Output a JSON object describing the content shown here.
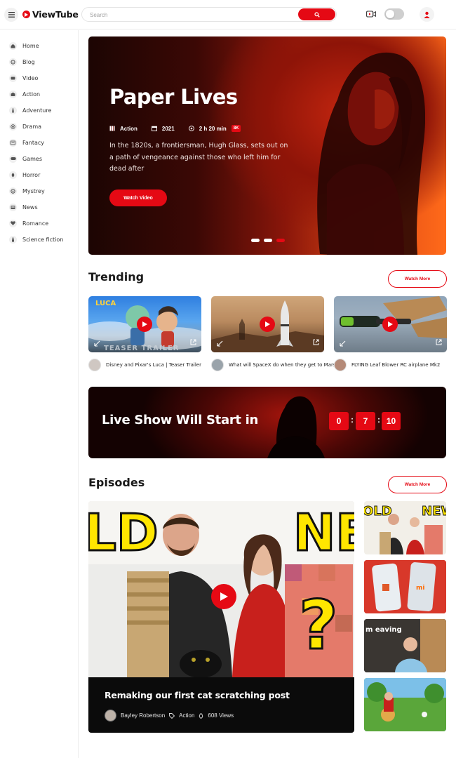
{
  "app": {
    "brand": "ViewTube",
    "search_placeholder": "Search"
  },
  "sidebar": {
    "items": [
      {
        "label": "Home",
        "icon": "home-icon"
      },
      {
        "label": "Blog",
        "icon": "blog-icon"
      },
      {
        "label": "Video",
        "icon": "video-icon"
      },
      {
        "label": "Action",
        "icon": "camera-icon"
      },
      {
        "label": "Adventure",
        "icon": "hiker-icon"
      },
      {
        "label": "Drama",
        "icon": "drama-icon"
      },
      {
        "label": "Fantacy",
        "icon": "fantasy-icon"
      },
      {
        "label": "Games",
        "icon": "gamepad-icon"
      },
      {
        "label": "Horror",
        "icon": "horror-icon"
      },
      {
        "label": "Mystrey",
        "icon": "mystery-icon"
      },
      {
        "label": "News",
        "icon": "news-icon"
      },
      {
        "label": "Romance",
        "icon": "heart-icon"
      },
      {
        "label": "Science fiction",
        "icon": "scifi-icon"
      }
    ]
  },
  "hero": {
    "title": "Paper Lives",
    "genre": "Action",
    "year": "2021",
    "duration": "2 h 20 min",
    "quality": "8K",
    "description": "In the 1820s, a frontiersman, Hugh Glass, sets out on a path of vengeance against those who left him for dead after",
    "watch_label": "Watch Video",
    "slides": 3,
    "active_slide": 3
  },
  "trending": {
    "title": "Trending",
    "watch_more": "Watch More",
    "cards": [
      {
        "title": "Disney and Pixar's Luca | Teaser Trailer",
        "overlay": "TEASER TRAILER",
        "brand": "LUCA"
      },
      {
        "title": "What will SpaceX do when they get to Mars?"
      },
      {
        "title": "FLYING Leaf Blower RC airplane Mk2"
      }
    ]
  },
  "live": {
    "title": "Live Show Will Start in",
    "countdown": [
      "0",
      "7",
      "10"
    ]
  },
  "episodes": {
    "title": "Episodes",
    "watch_more": "Watch More",
    "main": {
      "title": "Remaking our first cat scratching post",
      "author": "Bayley Robertson",
      "category": "Action",
      "views": "608 Views",
      "thumb_text_left": "LD",
      "thumb_text_right": "NE"
    },
    "side": [
      {
        "thumb_text_left": "OLD",
        "thumb_text_right": "NEW"
      },
      {
        "thumb_text": "mi"
      },
      {
        "thumb_text": "m eaving"
      },
      {
        "thumb_text": ""
      }
    ]
  },
  "colors": {
    "accent": "#e50914",
    "dark": "#0b0b0b"
  }
}
